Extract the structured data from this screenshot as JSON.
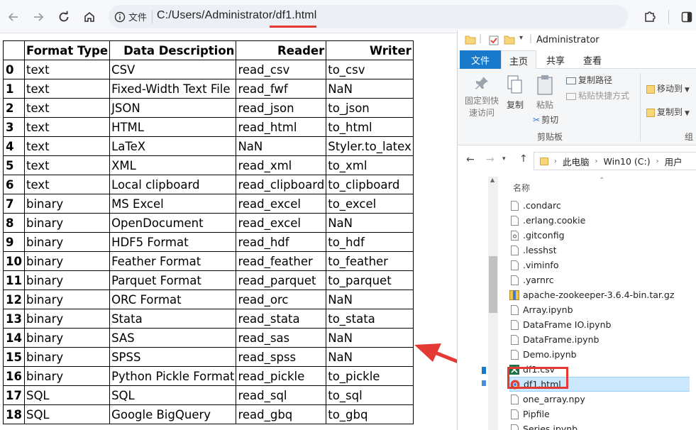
{
  "browser": {
    "info_chip_label": "文件",
    "url": "C:/Users/Administrator/df1.html"
  },
  "table": {
    "columns": [
      "",
      "Format Type",
      "Data Description",
      "Reader",
      "Writer"
    ],
    "rows": [
      {
        "index": "0",
        "type": "text",
        "desc": "CSV",
        "reader": "read_csv",
        "writer": "to_csv"
      },
      {
        "index": "1",
        "type": "text",
        "desc": "Fixed-Width Text File",
        "reader": "read_fwf",
        "writer": "NaN"
      },
      {
        "index": "2",
        "type": "text",
        "desc": "JSON",
        "reader": "read_json",
        "writer": "to_json"
      },
      {
        "index": "3",
        "type": "text",
        "desc": "HTML",
        "reader": "read_html",
        "writer": "to_html"
      },
      {
        "index": "4",
        "type": "text",
        "desc": "LaTeX",
        "reader": "NaN",
        "writer": "Styler.to_latex"
      },
      {
        "index": "5",
        "type": "text",
        "desc": "XML",
        "reader": "read_xml",
        "writer": "to_xml"
      },
      {
        "index": "6",
        "type": "text",
        "desc": "Local clipboard",
        "reader": "read_clipboard",
        "writer": "to_clipboard"
      },
      {
        "index": "7",
        "type": "binary",
        "desc": "MS Excel",
        "reader": "read_excel",
        "writer": "to_excel"
      },
      {
        "index": "8",
        "type": "binary",
        "desc": "OpenDocument",
        "reader": "read_excel",
        "writer": "NaN"
      },
      {
        "index": "9",
        "type": "binary",
        "desc": "HDF5 Format",
        "reader": "read_hdf",
        "writer": "to_hdf"
      },
      {
        "index": "10",
        "type": "binary",
        "desc": "Feather Format",
        "reader": "read_feather",
        "writer": "to_feather"
      },
      {
        "index": "11",
        "type": "binary",
        "desc": "Parquet Format",
        "reader": "read_parquet",
        "writer": "to_parquet"
      },
      {
        "index": "12",
        "type": "binary",
        "desc": "ORC Format",
        "reader": "read_orc",
        "writer": "NaN"
      },
      {
        "index": "13",
        "type": "binary",
        "desc": "Stata",
        "reader": "read_stata",
        "writer": "to_stata"
      },
      {
        "index": "14",
        "type": "binary",
        "desc": "SAS",
        "reader": "read_sas",
        "writer": "NaN"
      },
      {
        "index": "15",
        "type": "binary",
        "desc": "SPSS",
        "reader": "read_spss",
        "writer": "NaN"
      },
      {
        "index": "16",
        "type": "binary",
        "desc": "Python Pickle Format",
        "reader": "read_pickle",
        "writer": "to_pickle"
      },
      {
        "index": "17",
        "type": "SQL",
        "desc": "SQL",
        "reader": "read_sql",
        "writer": "to_sql"
      },
      {
        "index": "18",
        "type": "SQL",
        "desc": "Google BigQuery",
        "reader": "read_gbq",
        "writer": "to_gbq"
      }
    ]
  },
  "explorer": {
    "title": "Administrator",
    "tabs": {
      "file": "文件",
      "home": "主页",
      "share": "共享",
      "view": "查看"
    },
    "ribbon": {
      "pin": "固定到快\n速访问",
      "copy": "复制",
      "paste": "粘贴",
      "copy_path": "复制路径",
      "paste_shortcut": "粘贴快捷方式",
      "cut": "剪切",
      "clipboard_group": "剪贴板",
      "move_to": "移动到",
      "copy_to": "复制到",
      "org_group": "组"
    },
    "address": [
      "此电脑",
      "Win10 (C:)",
      "用户"
    ],
    "column_name": "名称",
    "files": [
      {
        "name": ".condarc",
        "icon": "blank-file-icon"
      },
      {
        "name": ".erlang.cookie",
        "icon": "blank-file-icon"
      },
      {
        "name": ".gitconfig",
        "icon": "config-file-icon"
      },
      {
        "name": ".lesshst",
        "icon": "blank-file-icon"
      },
      {
        "name": ".viminfo",
        "icon": "blank-file-icon"
      },
      {
        "name": ".yarnrc",
        "icon": "blank-file-icon"
      },
      {
        "name": "apache-zookeeper-3.6.4-bin.tar.gz",
        "icon": "archive-icon"
      },
      {
        "name": "Array.ipynb",
        "icon": "blank-file-icon"
      },
      {
        "name": "DataFrame IO.ipynb",
        "icon": "blank-file-icon"
      },
      {
        "name": "DataFrame.ipynb",
        "icon": "blank-file-icon"
      },
      {
        "name": "Demo.ipynb",
        "icon": "blank-file-icon"
      },
      {
        "name": "df1.csv",
        "icon": "excel-icon"
      },
      {
        "name": "df1.html",
        "icon": "chrome-icon",
        "selected": true
      },
      {
        "name": "one_array.npy",
        "icon": "blank-file-icon"
      },
      {
        "name": "Pipfile",
        "icon": "blank-file-icon"
      },
      {
        "name": "Series.ipynb",
        "icon": "blank-file-icon"
      }
    ]
  },
  "colors": {
    "accent_red": "#e53935",
    "ribbon_blue": "#1979ca",
    "selection": "#cce8ff"
  }
}
